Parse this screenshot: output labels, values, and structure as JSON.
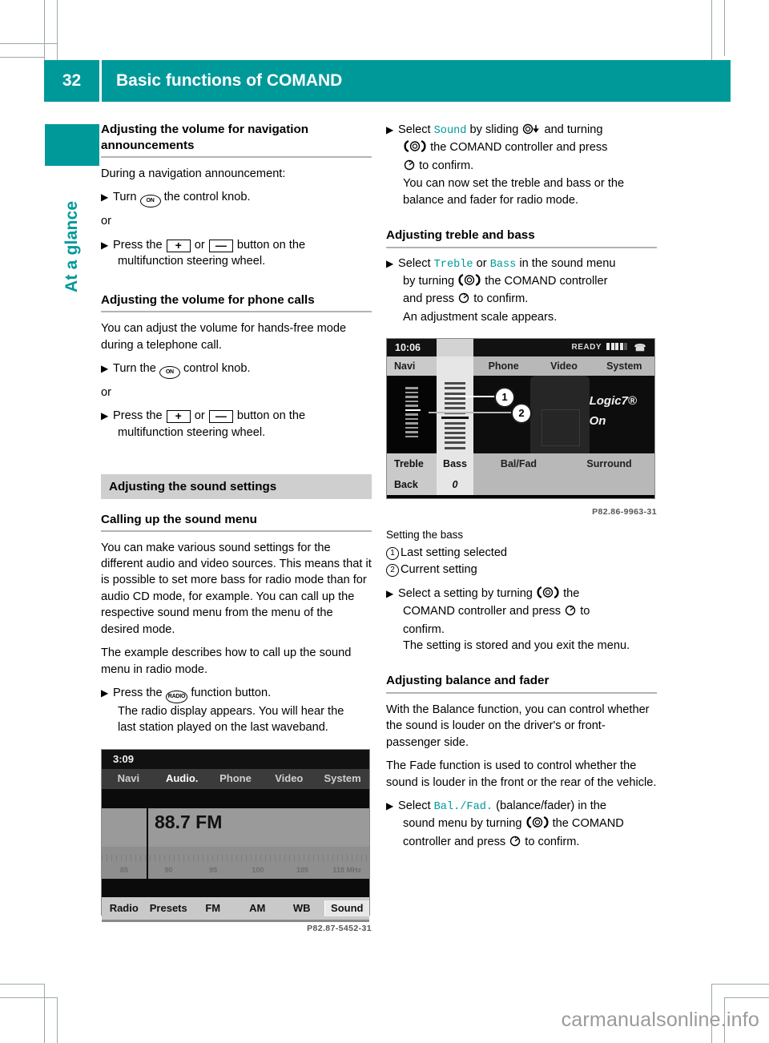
{
  "header": {
    "page_number": "32",
    "title": "Basic functions of COMAND",
    "accent_color": "#00999a"
  },
  "side_tab": {
    "label": "At a glance"
  },
  "watermark": "carmanualsonline.info",
  "left_column": {
    "heading_nav_volume": "Adjusting the volume for navigation announcements",
    "nav_intro": "During a navigation announcement:",
    "nav_step_turn_pre": "Turn",
    "nav_step_turn_post": "the control knob.",
    "knob_icon_label": "ON",
    "or_1": "or",
    "nav_step_press_pre": "Press the",
    "plus_key": "+",
    "or_mid": "or",
    "minus_key": "—",
    "nav_step_press_post": "button on the",
    "nav_step_press_cont": "multifunction steering wheel.",
    "heading_phone_volume": "Adjusting the volume for phone calls",
    "phone_intro": "You can adjust the volume for hands-free mode during a telephone call.",
    "phone_step_turn_pre": "Turn the",
    "phone_step_turn_post": "control knob.",
    "or_2": "or",
    "phone_step_press_pre": "Press the",
    "phone_step_press_post": "button on the",
    "phone_step_press_cont": "multifunction steering wheel.",
    "band_heading": "Adjusting the sound settings",
    "heading_sound_menu": "Calling up the sound menu",
    "sound_para_1": "You can make various sound settings for the different audio and video sources. This means that it is possible to set more bass for radio mode than for audio CD mode, for example. You can call up the respective sound menu from the menu of the desired mode.",
    "sound_para_2": "The example describes how to call up the sound menu in radio mode.",
    "radio_step_pre": "Press the",
    "radio_btn_label": "RADIO",
    "radio_step_post": "function button.",
    "radio_step_cont_1": "The radio display appears. You will hear the",
    "radio_step_cont_2": "last station played on the last waveband."
  },
  "radio_display": {
    "time": "3:09",
    "menu_items": [
      "Navi",
      "Audio.",
      "Phone",
      "Video",
      "System"
    ],
    "active_menu_item": "Audio.",
    "frequency": "88.7 FM",
    "scale_labels": [
      "85",
      "90",
      "95",
      "100",
      "105",
      "110 MHz"
    ],
    "softkeys": [
      "Radio",
      "Presets",
      "FM",
      "AM",
      "WB",
      "Sound"
    ],
    "selected_softkey": "Sound",
    "caption": "P82.87-5452-31"
  },
  "right_column": {
    "step_sound_pre": "Select",
    "step_sound_term": "Sound",
    "step_sound_mid1": "by sliding",
    "step_sound_mid2": "and turning",
    "step_sound_cont1": "the COMAND controller and press",
    "step_sound_cont2": "to confirm.",
    "step_sound_result": "You can now set the treble and bass or the balance and fader for radio mode.",
    "heading_treble_bass": "Adjusting treble and bass",
    "step_treble_pre": "Select",
    "step_treble_term": "Treble",
    "step_treble_or": "or",
    "step_bass_term": "Bass",
    "step_treble_post": "in the sound menu",
    "step_treble_cont1": "by turning",
    "step_treble_cont2": "the COMAND controller",
    "step_treble_cont3": "and press",
    "step_treble_cont4": "to confirm.",
    "step_treble_result": "An adjustment scale appears.",
    "legend_title": "Setting the bass",
    "legend_items": [
      {
        "num": "1",
        "text": "Last setting selected"
      },
      {
        "num": "2",
        "text": "Current setting"
      }
    ],
    "step_setting_pre": "Select a setting by turning",
    "step_setting_post": "the",
    "step_setting_cont1": "COMAND controller and press",
    "step_setting_cont2": "to",
    "step_setting_cont3": "confirm.",
    "step_setting_result": "The setting is stored and you exit the menu.",
    "heading_balance_fader": "Adjusting balance and fader",
    "balance_para_1": "With the Balance function, you can control whether the sound is louder on the driver's or front-passenger side.",
    "balance_para_2": "The Fade function is used to control whether the sound is louder in the front or the rear of the vehicle.",
    "step_balfad_pre": "Select",
    "step_balfad_term": "Bal./Fad.",
    "step_balfad_post": "(balance/fader) in the",
    "step_balfad_cont1": "sound menu by turning",
    "step_balfad_cont2": "the COMAND",
    "step_balfad_cont3": "controller and press",
    "step_balfad_cont4": "to confirm."
  },
  "sound_display": {
    "time": "10:06",
    "status_text": "READY",
    "signal_bars_filled": 4,
    "signal_bars_total": 5,
    "phone_icon": "phone-icon",
    "menu_navi": "Navi",
    "menu_items": [
      "Phone",
      "Video",
      "System"
    ],
    "logic7_label": "Logic7®",
    "logic7_state": "On",
    "softkey_treble": "Treble",
    "softkey_bass": "Bass",
    "softkeys_right": [
      "Bal/Fad",
      "Surround"
    ],
    "back_label": "Back",
    "bass_value": "0",
    "callout_1": "1",
    "callout_2": "2",
    "caption": "P82.86-9963-31"
  }
}
